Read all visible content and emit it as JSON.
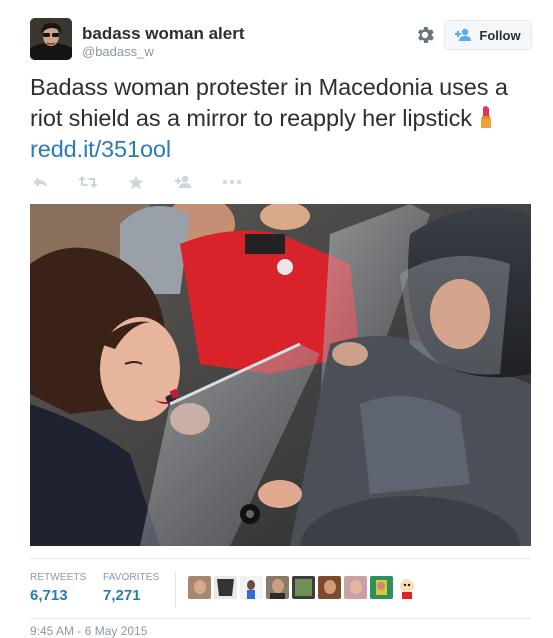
{
  "user": {
    "display_name": "badass woman alert",
    "handle": "@badass_w"
  },
  "header": {
    "follow_label": "Follow"
  },
  "tweet": {
    "text": "Badass woman protester in Macedonia uses a riot shield as a mirror to reapply her lipstick",
    "link": "redd.it/351ool"
  },
  "icons": {
    "settings": "gear-icon",
    "follow": "add-user-icon",
    "reply": "reply-icon",
    "retweet": "retweet-icon",
    "favorite": "star-icon",
    "follow_action": "add-user-icon",
    "more": "more-icon",
    "emoji": "lipstick-icon"
  },
  "stats": {
    "retweets_label": "RETWEETS",
    "retweets_value": "6,713",
    "favorites_label": "FAVORITES",
    "favorites_value": "7,271"
  },
  "timestamp": "9:45 AM - 6 May 2015",
  "colors": {
    "link": "#2b7bb9",
    "text": "#292f33",
    "muted": "#8899a6",
    "border": "#e1e8ed",
    "action_icon": "#ccd6dd"
  }
}
